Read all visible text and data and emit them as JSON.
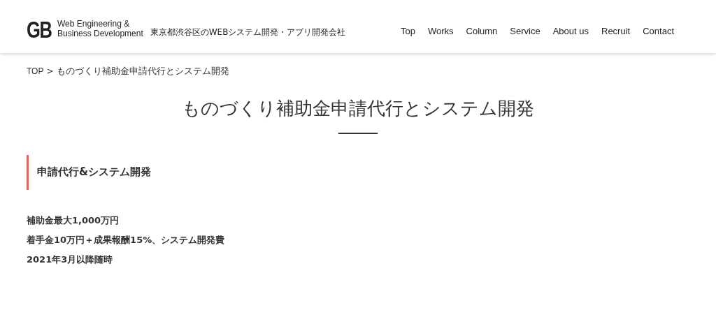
{
  "header": {
    "logo": "GB",
    "tagline": [
      "Web Engineering &",
      "Business Development"
    ],
    "description": "東京都渋谷区のWEBシステム開発・アプリ開発会社",
    "nav": [
      {
        "label": "Top"
      },
      {
        "label": "Works"
      },
      {
        "label": "Column"
      },
      {
        "label": "Service"
      },
      {
        "label": "About us"
      },
      {
        "label": "Recruit"
      },
      {
        "label": "Contact"
      }
    ]
  },
  "breadcrumb": {
    "home": "TOP",
    "separator": ">",
    "current": "ものづくり補助金申請代行とシステム開発"
  },
  "title": "ものづくり補助金申請代行とシステム開発",
  "section": {
    "heading": "申請代行&システム開発",
    "lines": [
      "補助金最大1,000万円",
      "着手金10万円＋成果報酬15%、システム開発費",
      "2021年3月以降随時"
    ]
  }
}
